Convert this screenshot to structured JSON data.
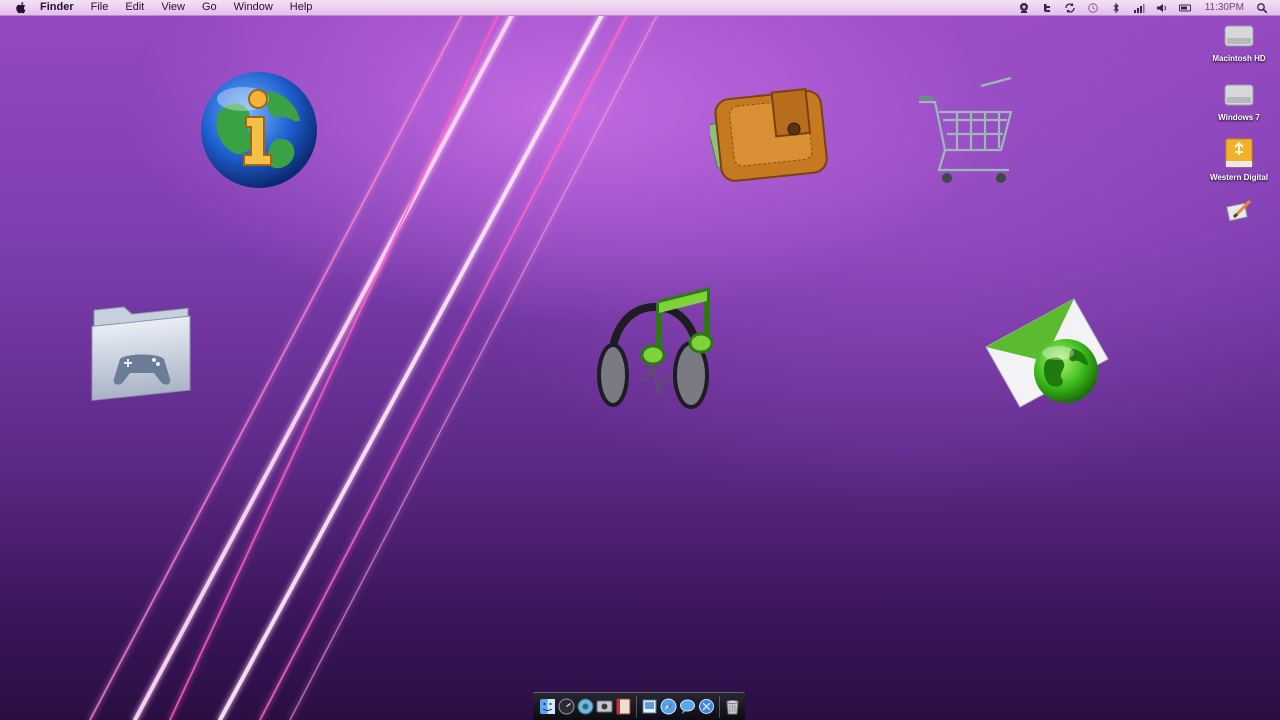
{
  "menubar": {
    "app_name": "Finder",
    "menus": [
      "File",
      "Edit",
      "View",
      "Go",
      "Window",
      "Help"
    ],
    "status_icons": [
      "webcam-icon",
      "twitter-icon",
      "sync-icon",
      "time-machine-icon",
      "bluetooth-icon",
      "wifi-icon",
      "volume-icon",
      "battery-icon"
    ],
    "clock": "11:30PM"
  },
  "volumes": [
    {
      "label": "Macintosh HD",
      "icon": "hard-drive-icon"
    },
    {
      "label": "Windows 7",
      "icon": "hard-drive-icon"
    },
    {
      "label": "Western Digital",
      "icon": "usb-drive-icon"
    },
    {
      "label": "",
      "icon": "document-pen-icon"
    }
  ],
  "desktop_icons": [
    "info-globe-icon",
    "wallet-icon",
    "shopping-cart-icon",
    "games-folder-icon",
    "music-headphones-icon",
    "mail-globe-icon"
  ],
  "dock": {
    "apps": [
      "finder-icon",
      "dashboard-icon",
      "itunes-icon",
      "screenshot-icon",
      "address-book-icon",
      "preview-icon",
      "safari-icon",
      "messages-icon",
      "system-prefs-icon"
    ],
    "running": [
      true,
      false,
      false,
      false,
      false,
      true,
      true,
      true,
      true
    ],
    "trash": "trash-icon"
  },
  "colors": {
    "desktop_top": "#9549c2",
    "desktop_bottom": "#2a0e42",
    "streak": "#ff7fd6",
    "menubar": "#e3bfea"
  }
}
